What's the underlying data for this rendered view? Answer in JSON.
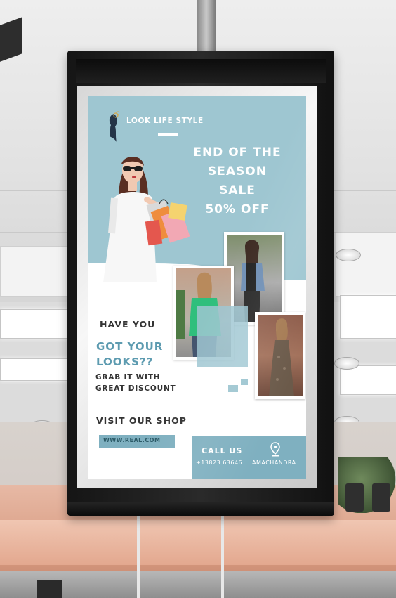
{
  "poster": {
    "brand": "LOOK LIFE STYLE",
    "headline": [
      "END OF THE",
      "SEASON",
      "SALE",
      "50% OFF"
    ],
    "question_line1": "HAVE YOU",
    "question_line2": [
      "GOT YOUR",
      "LOOKS??"
    ],
    "subtext": [
      "GRAB IT WITH",
      "GREAT DISCOUNT"
    ],
    "cta": "VISIT OUR SHOP",
    "website": "WWW.REAL.COM",
    "call_label": "CALL US",
    "phone": "+13823 63646",
    "location": "AMACHANDRA"
  },
  "colors": {
    "poster_blue": "#9ec6d1",
    "accent_blue": "#5d9bb0",
    "box_blue": "#7fb0c0",
    "frame": "#151515"
  },
  "icons": [
    "woman-silhouette-logo-icon",
    "location-pin-icon"
  ]
}
